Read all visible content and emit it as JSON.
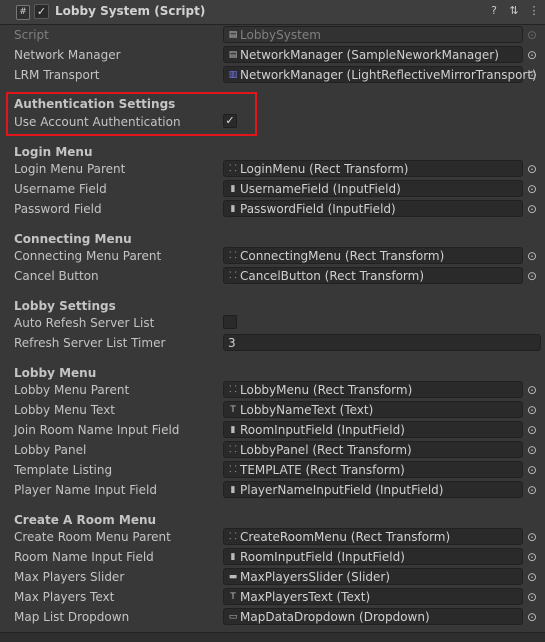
{
  "header": {
    "title": "Lobby System (Script)",
    "enabled": true,
    "icons": [
      "script-icon",
      "help-icon",
      "preset-icon",
      "more-icon"
    ]
  },
  "fields": {
    "script": {
      "label": "Script",
      "value": "LobbySystem"
    },
    "network_manager": {
      "label": "Network Manager",
      "value": "NetworkManager (SampleNeworkManager)"
    },
    "lrm_transport": {
      "label": "LRM Transport",
      "value": "NetworkManager (LightReflectiveMirrorTransport)"
    }
  },
  "auth": {
    "header": "Authentication Settings",
    "use_account_auth_label": "Use Account Authentication",
    "use_account_auth_checked": true
  },
  "login": {
    "header": "Login Menu",
    "rows": [
      {
        "label": "Login Menu Parent",
        "value": "LoginMenu (Rect Transform)",
        "icon": "rect-transform-icon"
      },
      {
        "label": "Username Field",
        "value": "UsernameField (InputField)",
        "icon": "input-field-icon"
      },
      {
        "label": "Password Field",
        "value": "PasswordField (InputField)",
        "icon": "input-field-icon"
      }
    ]
  },
  "connecting": {
    "header": "Connecting Menu",
    "rows": [
      {
        "label": "Connecting Menu Parent",
        "value": "ConnectingMenu (Rect Transform)",
        "icon": "rect-transform-icon"
      },
      {
        "label": "Cancel Button",
        "value": "CancelButton (Rect Transform)",
        "icon": "rect-transform-icon"
      }
    ]
  },
  "lobby_settings": {
    "header": "Lobby Settings",
    "auto_refresh_label": "Auto Refesh Server List",
    "auto_refresh_checked": false,
    "refresh_timer_label": "Refresh Server List Timer",
    "refresh_timer_value": "3"
  },
  "lobby_menu": {
    "header": "Lobby Menu",
    "rows": [
      {
        "label": "Lobby Menu Parent",
        "value": "LobbyMenu (Rect Transform)",
        "icon": "rect-transform-icon"
      },
      {
        "label": "Lobby Menu Text",
        "value": "LobbyNameText (Text)",
        "icon": "text-icon"
      },
      {
        "label": "Join Room Name Input Field",
        "value": "RoomInputField (InputField)",
        "icon": "input-field-icon"
      },
      {
        "label": "Lobby Panel",
        "value": "LobbyPanel (Rect Transform)",
        "icon": "rect-transform-icon"
      },
      {
        "label": "Template Listing",
        "value": "TEMPLATE (Rect Transform)",
        "icon": "rect-transform-icon"
      },
      {
        "label": "Player Name Input Field",
        "value": "PlayerNameInputField (InputField)",
        "icon": "input-field-icon"
      }
    ]
  },
  "create_room": {
    "header": "Create A Room Menu",
    "rows": [
      {
        "label": "Create Room Menu Parent",
        "value": "CreateRoomMenu (Rect Transform)",
        "icon": "rect-transform-icon"
      },
      {
        "label": "Room Name Input Field",
        "value": "RoomInputField (InputField)",
        "icon": "input-field-icon"
      },
      {
        "label": "Max Players Slider",
        "value": "MaxPlayersSlider (Slider)",
        "icon": "slider-icon"
      },
      {
        "label": "Max Players Text",
        "value": "MaxPlayersText (Text)",
        "icon": "text-icon"
      },
      {
        "label": "Map List Dropdown",
        "value": "MapDataDropdown (Dropdown)",
        "icon": "dropdown-icon"
      }
    ]
  },
  "colors": {
    "background": "#383838",
    "field_background": "#2a2a2a",
    "highlight_border": "#e0161b"
  }
}
